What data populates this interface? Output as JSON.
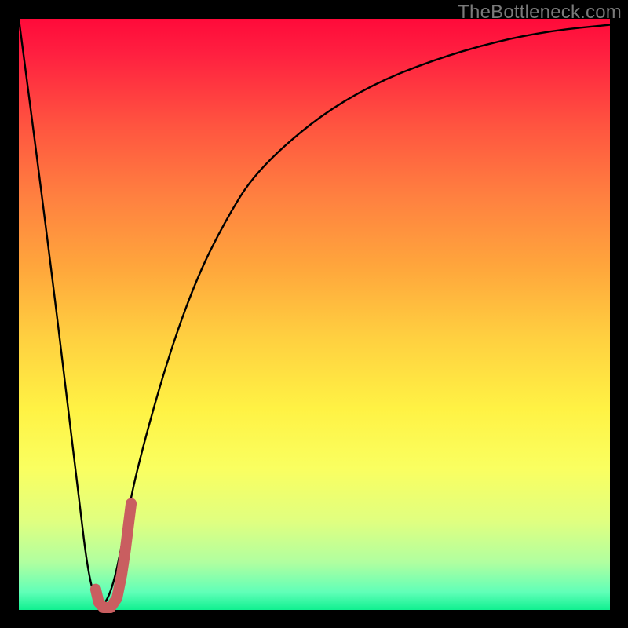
{
  "watermark": "TheBottleneck.com",
  "colors": {
    "frame": "#000000",
    "curve": "#000000",
    "marker": "#c95e60",
    "gradient_top": "#ff0a3a",
    "gradient_bottom": "#10f090"
  },
  "chart_data": {
    "type": "line",
    "title": "",
    "xlabel": "",
    "ylabel": "",
    "xlim": [
      0,
      100
    ],
    "ylim": [
      0,
      100
    ],
    "series": [
      {
        "name": "bottleneck-curve",
        "x": [
          0,
          5,
          10,
          12,
          14,
          16,
          18,
          20,
          25,
          30,
          35,
          40,
          50,
          60,
          70,
          80,
          90,
          100
        ],
        "values": [
          100,
          62,
          20,
          4,
          0,
          4,
          14,
          24,
          42,
          56,
          66,
          74,
          83,
          89,
          93,
          96,
          98,
          99
        ]
      }
    ],
    "annotations": [
      {
        "name": "highlight-j",
        "type": "path",
        "x": [
          13.0,
          13.5,
          14.3,
          15.5,
          16.6,
          17.4,
          18.0,
          18.5,
          19.0
        ],
        "values": [
          3.5,
          1.3,
          0.4,
          0.4,
          2.0,
          6.0,
          10.0,
          14.0,
          18.0
        ]
      }
    ]
  }
}
